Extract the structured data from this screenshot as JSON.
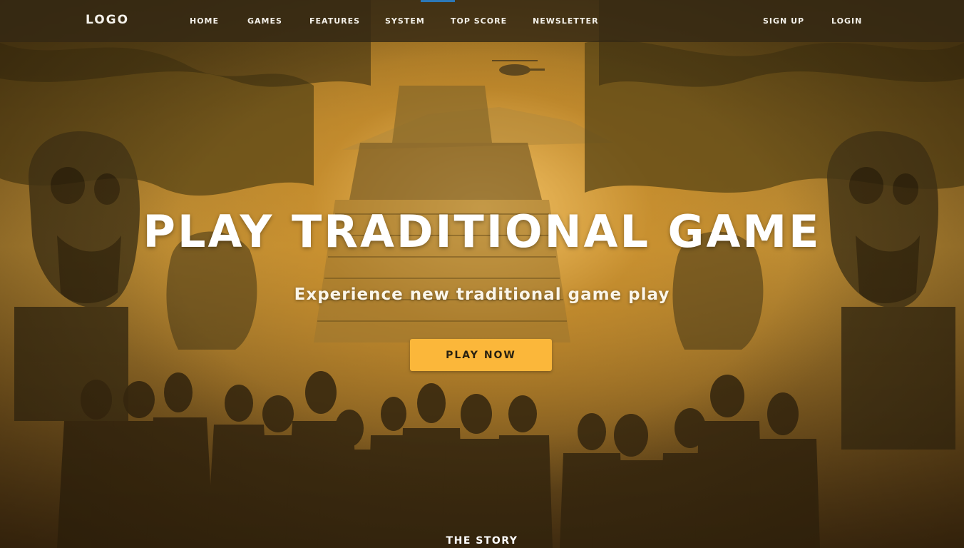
{
  "nav": {
    "logo": "LOGO",
    "items": [
      "HOME",
      "GAMES",
      "FEATURES",
      "SYSTEM",
      "TOP SCORE",
      "NEWSLETTER"
    ],
    "sign_up": "SIGN UP",
    "login": "LOGIN"
  },
  "hero": {
    "title": "PLAY TRADITIONAL GAME",
    "subtitle": "Experience new traditional game play",
    "cta": "PLAY NOW",
    "section_label": "THE STORY"
  },
  "colors": {
    "cta_background": "#fbb73a",
    "nav_background": "#342814",
    "active_marker": "#2c78b8",
    "text": "#ffffff"
  }
}
